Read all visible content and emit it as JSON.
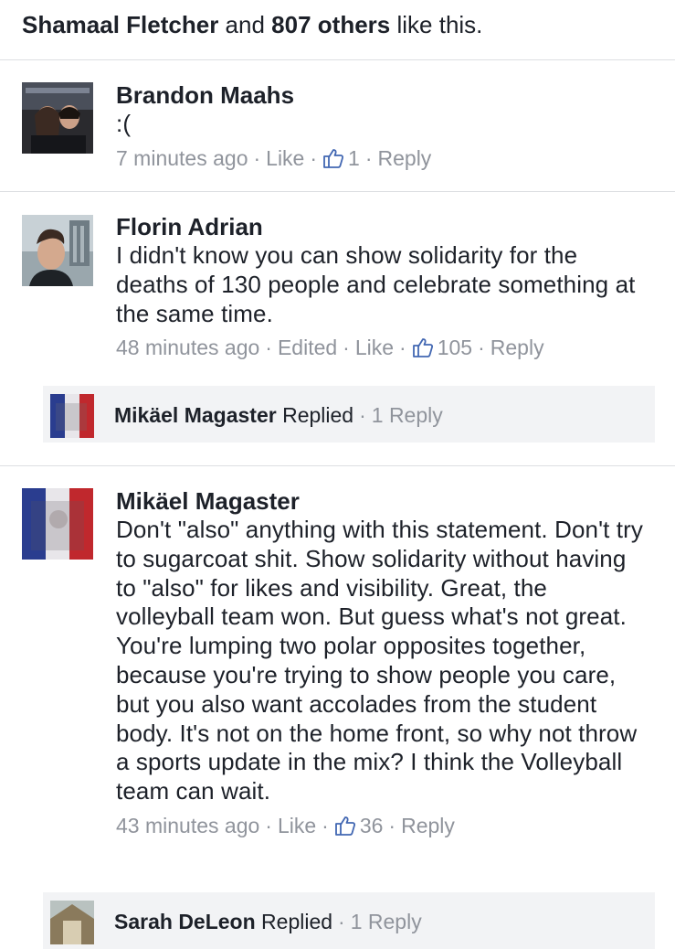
{
  "likes_summary": {
    "first_name": "Shamaal Fletcher",
    "and_word": "and",
    "others": "807 others",
    "suffix": "like this."
  },
  "comments": [
    {
      "author": "Brandon Maahs",
      "text": ":(",
      "time": "7 minutes ago",
      "edited": "",
      "like_label": "Like",
      "like_count": "1",
      "reply_label": "Reply"
    },
    {
      "author": "Florin Adrian",
      "text": "I didn't know you can show solidarity for the deaths of 130 people and celebrate something at the same time.",
      "time": "48 minutes ago",
      "edited": "Edited",
      "like_label": "Like",
      "like_count": "105",
      "reply_label": "Reply",
      "reply_preview": {
        "name": "Mikäel Magaster",
        "action": "Replied",
        "count": "1 Reply"
      }
    },
    {
      "author": "Mikäel Magaster",
      "text": "Don't \"also\" anything with this statement. Don't try to sugarcoat shit. Show solidarity without having to \"also\" for likes and visibility. Great, the volleyball team won. But guess what's not great. You're lumping two polar opposites together, because you're trying to show people you care, but you also want accolades from the student body. It's not on the home front, so why not throw a sports update in the mix? I think the Volleyball team can wait.",
      "time": "43 minutes ago",
      "edited": "",
      "like_label": "Like",
      "like_count": "36",
      "reply_label": "Reply",
      "reply_preview": {
        "name": "Sarah DeLeon",
        "action": "Replied",
        "count": "1 Reply"
      }
    }
  ],
  "colors": {
    "text": "#1d2129",
    "meta": "#90949c",
    "divider": "#dddfe2",
    "reply_bg": "#f2f3f5",
    "flag_blue": "#2a3d8f",
    "flag_red": "#c0282d"
  },
  "icons": {
    "like": "thumbs-up-icon",
    "avatar_brandon": "photo-avatar",
    "avatar_florin": "photo-avatar",
    "avatar_mikael": "french-flag-avatar",
    "avatar_sarah": "photo-avatar"
  }
}
